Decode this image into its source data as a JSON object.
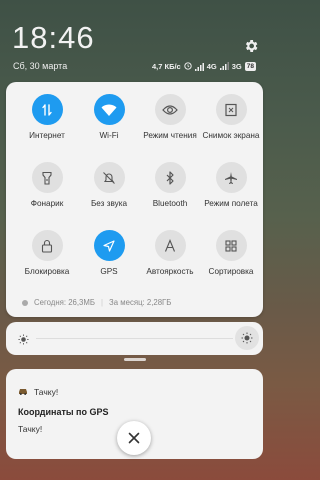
{
  "status": {
    "time": "18:46",
    "date": "Сб, 30 марта",
    "speed": "4,7 КБ/с",
    "net1": "4G",
    "net2": "3G",
    "battery": "78"
  },
  "tiles": [
    {
      "label": "Интернет",
      "icon": "mobile-data-icon",
      "on": true
    },
    {
      "label": "Wi-Fi",
      "icon": "wifi-icon",
      "on": true
    },
    {
      "label": "Режим чтения",
      "icon": "eye-icon",
      "on": false
    },
    {
      "label": "Снимок экрана",
      "icon": "screenshot-icon",
      "on": false
    },
    {
      "label": "Фонарик",
      "icon": "flashlight-icon",
      "on": false
    },
    {
      "label": "Без звука",
      "icon": "bell-off-icon",
      "on": false
    },
    {
      "label": "Bluetooth",
      "icon": "bluetooth-icon",
      "on": false
    },
    {
      "label": "Режим полета",
      "icon": "airplane-icon",
      "on": false
    },
    {
      "label": "Блокировка",
      "icon": "lock-icon",
      "on": false
    },
    {
      "label": "GPS",
      "icon": "location-icon",
      "on": true
    },
    {
      "label": "Автояркость",
      "icon": "auto-brightness-icon",
      "on": false
    },
    {
      "label": "Сортировка",
      "icon": "grid-icon",
      "on": false
    }
  ],
  "usage": {
    "today": "Сегодня: 26,3МБ",
    "month": "За месяц: 2,28ГБ"
  },
  "notification": {
    "app": "Тачку!",
    "title": "Координаты по GPS",
    "text": "Тачку!"
  },
  "colors": {
    "accent": "#1e9bf0",
    "panel": "#f3f3f3"
  }
}
